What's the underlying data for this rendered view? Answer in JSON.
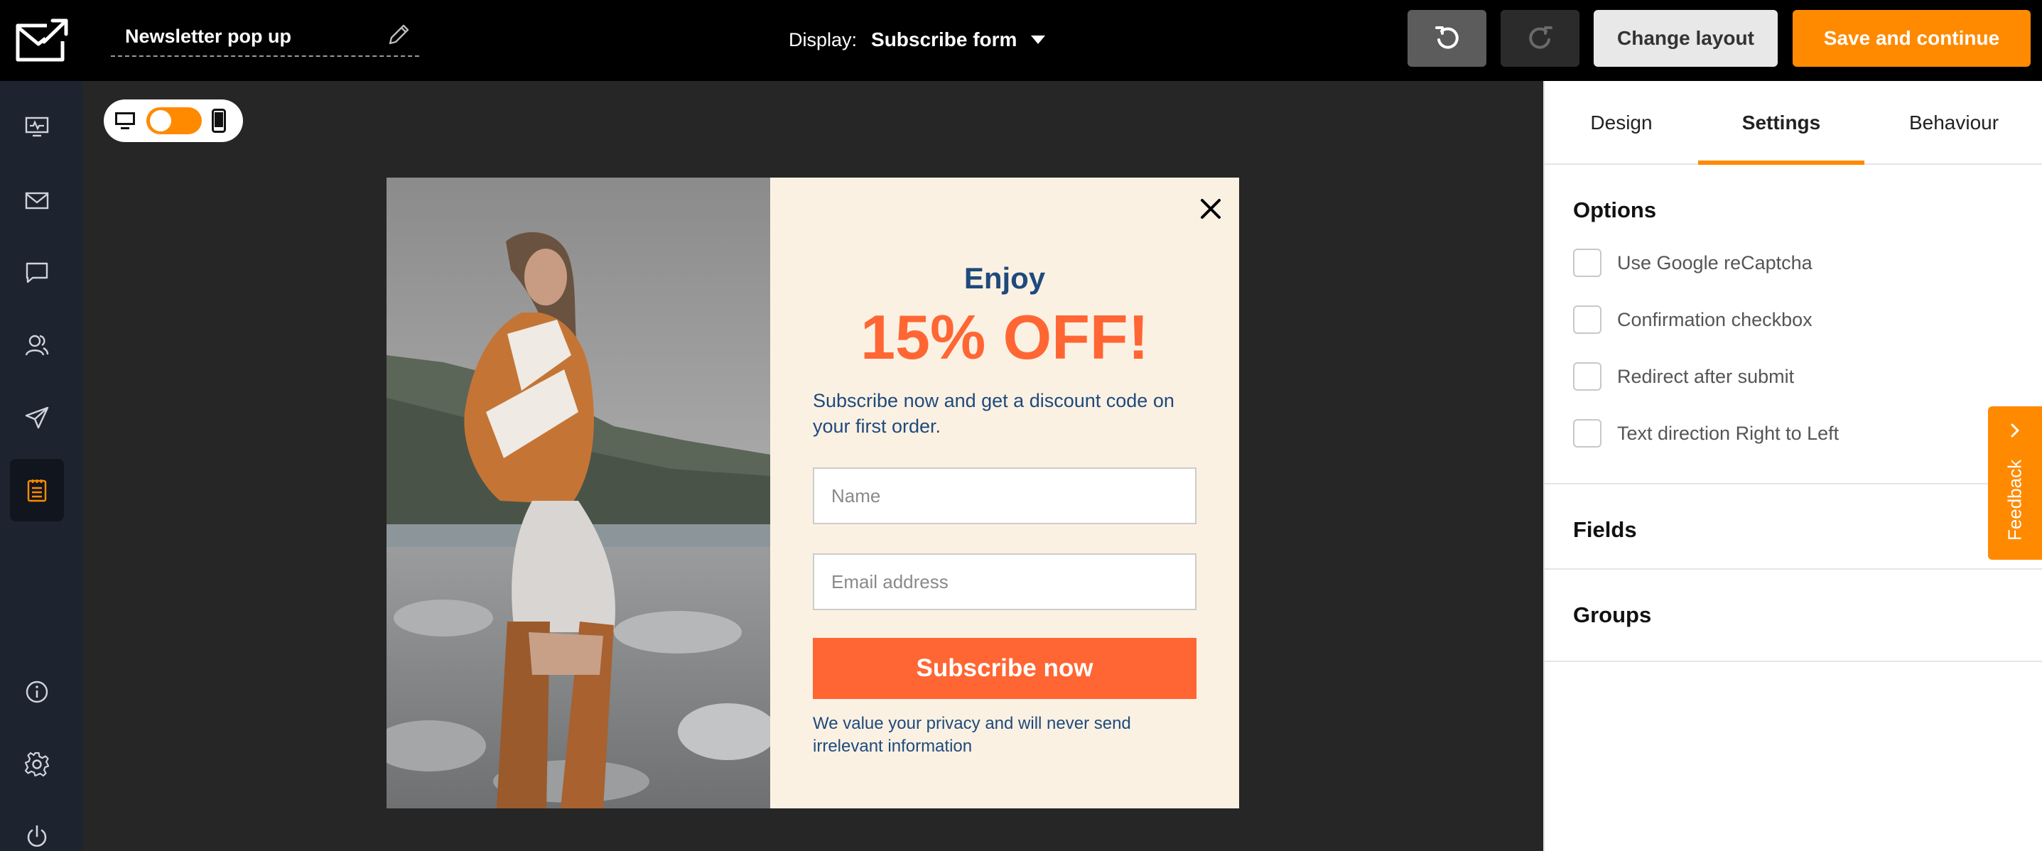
{
  "header": {
    "form_title": "Newsletter pop up",
    "display_label": "Display:",
    "display_value": "Subscribe form",
    "change_layout_label": "Change layout",
    "save_label": "Save and continue"
  },
  "sidebar": {
    "items": [
      {
        "icon": "dashboard-icon"
      },
      {
        "icon": "envelope-icon"
      },
      {
        "icon": "chat-icon"
      },
      {
        "icon": "subscribers-icon"
      },
      {
        "icon": "paper-plane-icon"
      },
      {
        "icon": "forms-icon",
        "active": true
      },
      {
        "icon": "info-icon"
      },
      {
        "icon": "gear-icon"
      },
      {
        "icon": "power-icon"
      }
    ]
  },
  "popup": {
    "heading": "Enjoy",
    "offer": "15% OFF!",
    "description": "Subscribe now and get a discount code on your first order.",
    "name_placeholder": "Name",
    "email_placeholder": "Email address",
    "button_label": "Subscribe now",
    "privacy_text": "We value your privacy and will never send irrelevant information"
  },
  "panel": {
    "tabs": [
      "Design",
      "Settings",
      "Behaviour"
    ],
    "active_tab": "Settings",
    "options_title": "Options",
    "options": [
      "Use Google reCaptcha",
      "Confirmation checkbox",
      "Redirect after submit",
      "Text direction Right to Left"
    ],
    "fields_title": "Fields",
    "groups_title": "Groups"
  },
  "feedback_label": "Feedback",
  "colors": {
    "accent": "#ff8a00",
    "cta": "#ff6633",
    "popup_bg": "#fbf1e3",
    "popup_text": "#1e4a7c"
  }
}
